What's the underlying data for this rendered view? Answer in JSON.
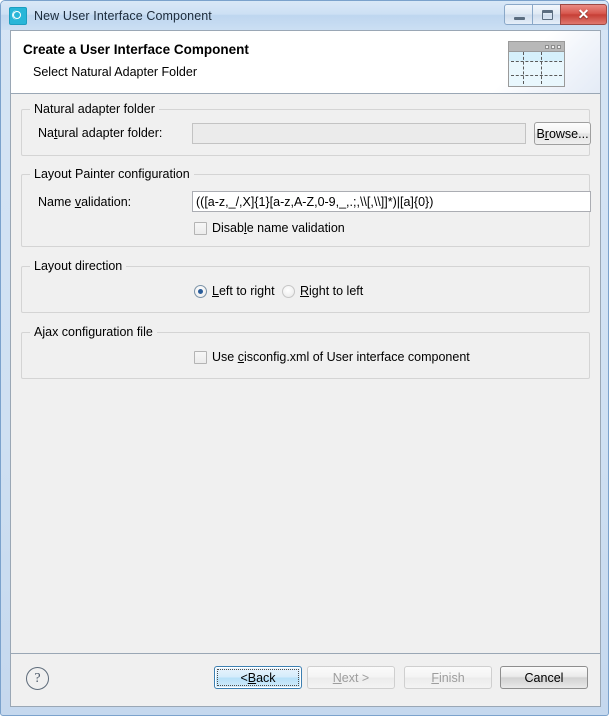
{
  "window": {
    "title": "New User Interface Component",
    "icon": "component-icon",
    "controls": {
      "minimize": "minimize-icon",
      "maximize": "maximize-icon",
      "close": "✕"
    }
  },
  "header": {
    "title": "Create a User Interface Component",
    "subtitle": "Select Natural Adapter Folder",
    "banner_icon": "layout-window-icon"
  },
  "groups": {
    "natural_adapter_folder": {
      "legend": "Natural adapter folder",
      "field": {
        "label_pre": "Na",
        "label_mnemonic": "t",
        "label_post": "ural adapter folder:",
        "value": "",
        "placeholder": "",
        "disabled": true
      },
      "browse_button": {
        "pre": "B",
        "mnemonic": "r",
        "post": "owse..."
      }
    },
    "layout_painter": {
      "legend": "Layout Painter configuration",
      "name_validation": {
        "label_pre": "Name ",
        "label_mnemonic": "v",
        "label_post": "alidation:",
        "value": "(([a-z,_/,X]{1}[a-z,A-Z,0-9,_,.;,\\\\[,\\\\]]*)|[a]{0})"
      },
      "disable_validation": {
        "pre": "Disab",
        "mnemonic": "l",
        "post": "e name validation",
        "checked": false
      }
    },
    "layout_direction": {
      "legend": "Layout direction",
      "options": [
        {
          "pre": "",
          "mnemonic": "L",
          "post": "eft to right",
          "selected": true
        },
        {
          "pre": "",
          "mnemonic": "R",
          "post": "ight to left",
          "selected": false
        }
      ]
    },
    "ajax_configuration": {
      "legend": "Ajax configuration file",
      "use_cisconfig": {
        "pre": "Use ",
        "mnemonic": "c",
        "post": "isconfig.xml of User interface component",
        "checked": false
      }
    }
  },
  "footer": {
    "help": "?",
    "buttons": [
      {
        "pre": "< ",
        "mnemonic": "B",
        "post": "ack",
        "state": "focused"
      },
      {
        "pre": "",
        "mnemonic": "N",
        "post": "ext >",
        "state": "disabled"
      },
      {
        "pre": "",
        "mnemonic": "F",
        "post": "inish",
        "state": "disabled"
      },
      {
        "pre": "Cancel",
        "mnemonic": "",
        "post": "",
        "state": "enabled"
      }
    ]
  },
  "colors": {
    "titlebar_top": "#d9e8f7",
    "frame_border": "#7ba2cc",
    "dialog_bg": "#f0f0f0",
    "header_bg": "#ffffff",
    "group_border": "#d4d4d4",
    "close_button": "#c63f36",
    "focus_border": "#3c7fb1",
    "radio_dot": "#2a5c99"
  }
}
